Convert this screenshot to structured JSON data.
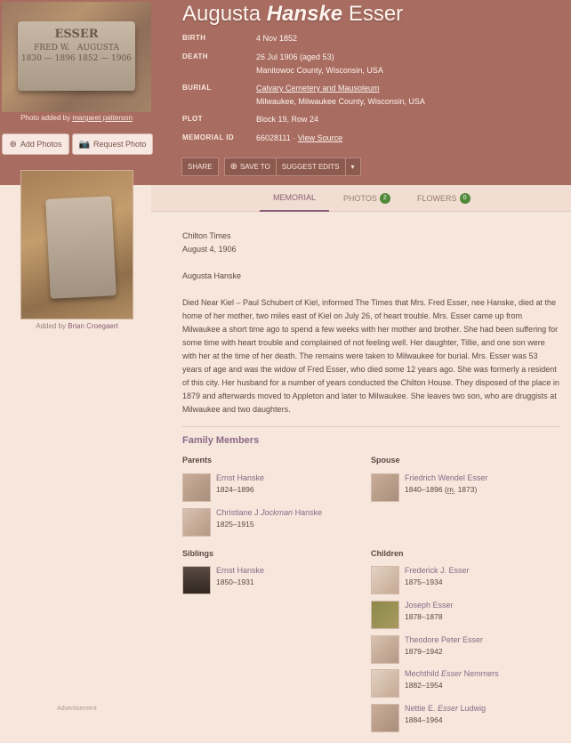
{
  "hero": {
    "stone_name": "ESSER",
    "stone_left": "FRED W.",
    "stone_right": "AUGUSTA",
    "stone_dates": "1830 — 1896   1852 — 1906",
    "caption_prefix": "Photo added by",
    "caption_user": "margaret patterson"
  },
  "buttons": {
    "add_photos": "Add Photos",
    "request_photo": "Request Photo"
  },
  "title": {
    "first": "Augusta",
    "maiden": "Hanske",
    "last": "Esser"
  },
  "facts": {
    "birth_label": "BIRTH",
    "birth_value": "4 Nov 1852",
    "death_label": "DEATH",
    "death_value": "26 Jul 1906 (aged 53)",
    "death_place": "Manitowoc County, Wisconsin, USA",
    "burial_label": "BURIAL",
    "burial_cemetery": "Calvary Cemetery and Mausoleum",
    "burial_place": "Milwaukee, Milwaukee County, Wisconsin, USA",
    "plot_label": "PLOT",
    "plot_value": "Block 19, Row 24",
    "memorial_label": "MEMORIAL ID",
    "memorial_value": "66028111 ·",
    "memorial_link": "View Source"
  },
  "actions": {
    "share": "SHARE",
    "save": "SAVE TO",
    "suggest": "SUGGEST EDITS",
    "more": "▾"
  },
  "tabs": {
    "memorial": "MEMORIAL",
    "photos": "PHOTOS",
    "photos_count": "2",
    "flowers": "FLOWERS",
    "flowers_count": "0"
  },
  "side": {
    "caption_prefix": "Added by",
    "caption_user": "Brian Croegaert",
    "ad": "Advertisement"
  },
  "bio": {
    "source": "Chilton Times",
    "date": "August 4, 1906",
    "name": "Augusta Hanske",
    "body": "Died Near Kiel – Paul Schubert of Kiel, informed The Times that Mrs. Fred Esser, nee Hanske, died at the home of her mother, two miles east of Kiel on July 26, of heart trouble. Mrs. Esser came up from Milwaukee a short time ago to spend a few weeks with her mother and brother. She had been suffering for some time with heart trouble and complained of not feeling well. Her daughter, Tillie, and one son were with her at the time of her death. The remains were taken to Milwaukee for burial. Mrs. Esser was 53 years of age and was the widow of Fred Esser, who died some 12 years ago. She was formerly a resident of this city. Her husband for a number of years conducted the Chilton House. They disposed of the place in 1879 and afterwards moved to Appleton and later to Milwaukee. She leaves two son, who are druggists at Milwaukee and two daughters."
  },
  "family": {
    "title": "Family Members",
    "parents_label": "Parents",
    "spouse_label": "Spouse",
    "siblings_label": "Siblings",
    "children_label": "Children",
    "parents": [
      {
        "name": "Ernst Hanske",
        "dates": "1824–1896"
      },
      {
        "name_pre": "Christiane J",
        "name_maiden": "Jockman",
        "name_post": "Hanske",
        "dates": "1825–1915"
      }
    ],
    "spouse": {
      "name": "Friedrich Wendel Esser",
      "dates": "1840–1896 (",
      "marr": "m.",
      "marr_year": " 1873)"
    },
    "siblings": [
      {
        "name": "Ernst Hanske",
        "dates": "1850–1931"
      }
    ],
    "children": [
      {
        "name": "Frederick J. Esser",
        "dates": "1875–1934"
      },
      {
        "name": "Joseph Esser",
        "dates": "1878–1878"
      },
      {
        "name": "Theodore Peter Esser",
        "dates": "1879–1942"
      },
      {
        "name_pre": "Mechthild",
        "name_maiden": "Esser",
        "name_post": "Nemmers",
        "dates": "1882–1954"
      },
      {
        "name_pre": "Nettie E.",
        "name_maiden": "Esser",
        "name_post": "Ludwig",
        "dates": "1884–1964"
      }
    ]
  }
}
